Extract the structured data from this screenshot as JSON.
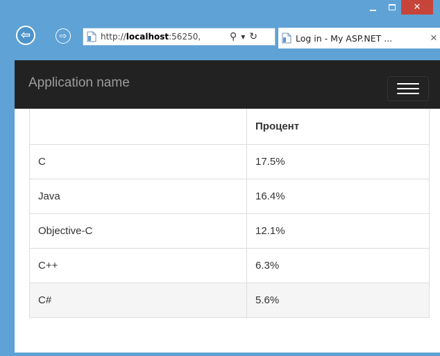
{
  "window": {
    "caption": {
      "minimize_icon": "minimize-icon",
      "maximize_icon": "maximize-icon",
      "close_glyph": "✕"
    }
  },
  "browser": {
    "back_glyph": "⇦",
    "forward_glyph": "⇨",
    "address_prefix": "http://",
    "address_host": "localhost",
    "address_suffix": ":56250,",
    "search_glyph": "⚲",
    "dropdown_glyph": "▾",
    "refresh_glyph": "↻",
    "tab_title": "Log in - My ASP.NET ...",
    "tab_close_glyph": "✕"
  },
  "navbar": {
    "brand": "Application name"
  },
  "table": {
    "headers": [
      "",
      "Процент"
    ],
    "rows": [
      {
        "lang": "C",
        "percent": "17.5%"
      },
      {
        "lang": "Java",
        "percent": "16.4%"
      },
      {
        "lang": "Objective-C",
        "percent": "12.1%"
      },
      {
        "lang": "C++",
        "percent": "6.3%"
      },
      {
        "lang": "C#",
        "percent": "5.6%"
      }
    ]
  },
  "colors": {
    "frame": "#5ea2d6",
    "close_button": "#c7443a",
    "navbar_bg": "#222222",
    "brand_text": "#9d9d9d",
    "table_border": "#dddddd",
    "highlight_row": "#f5f5f5"
  }
}
